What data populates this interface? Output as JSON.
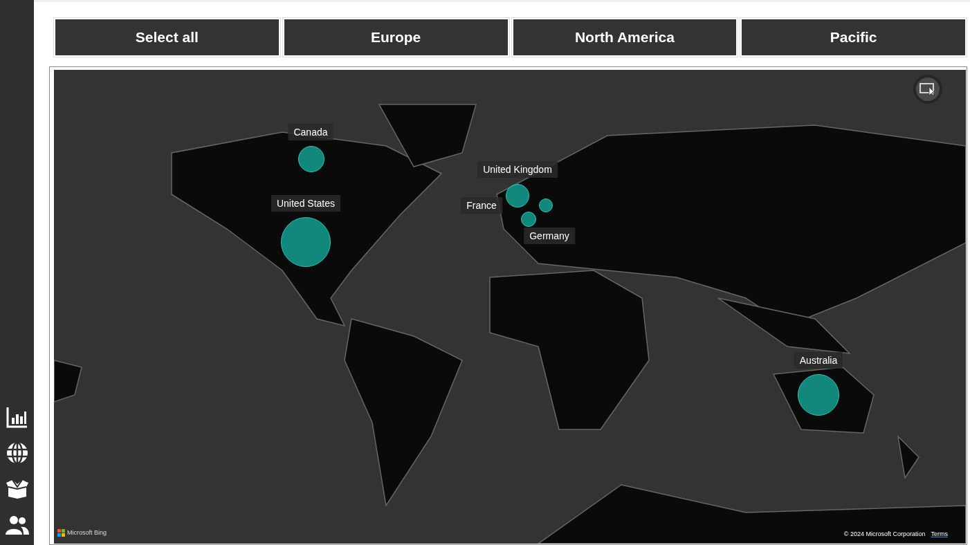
{
  "filter_buttons": [
    {
      "label": "Select all"
    },
    {
      "label": "Europe"
    },
    {
      "label": "North America"
    },
    {
      "label": "Pacific"
    }
  ],
  "map": {
    "kind": "picture",
    "bubbles": [
      {
        "label": "Canada"
      },
      {
        "label": "United States"
      },
      {
        "label": "United Kingdom"
      },
      {
        "label": "France"
      },
      {
        "label": "Germany"
      },
      {
        "label": "Australia"
      }
    ],
    "attribution": "Microsoft Bing",
    "copyright": "© 2024 Microsoft Corporation",
    "terms_link": "Terms"
  }
}
